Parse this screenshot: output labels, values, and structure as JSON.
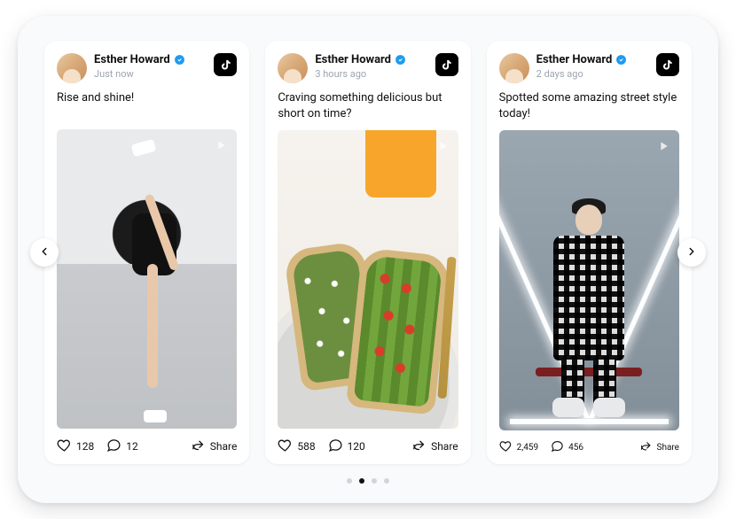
{
  "posts": [
    {
      "author": "Esther Howard",
      "verified": true,
      "timestamp": "Just now",
      "platform": "tiktok",
      "caption": "Rise and shine!",
      "likes": "128",
      "comments": "12",
      "share_label": "Share"
    },
    {
      "author": "Esther Howard",
      "verified": true,
      "timestamp": "3 hours ago",
      "platform": "tiktok",
      "caption": "Craving something delicious but short on time?",
      "likes": "588",
      "comments": "120",
      "share_label": "Share"
    },
    {
      "author": "Esther Howard",
      "verified": true,
      "timestamp": "2 days ago",
      "platform": "tiktok",
      "caption": "Spotted some amazing street style today!",
      "likes": "2,459",
      "comments": "456",
      "share_label": "Share"
    }
  ],
  "pagination": {
    "total_dots": 4,
    "active_index": 1
  }
}
